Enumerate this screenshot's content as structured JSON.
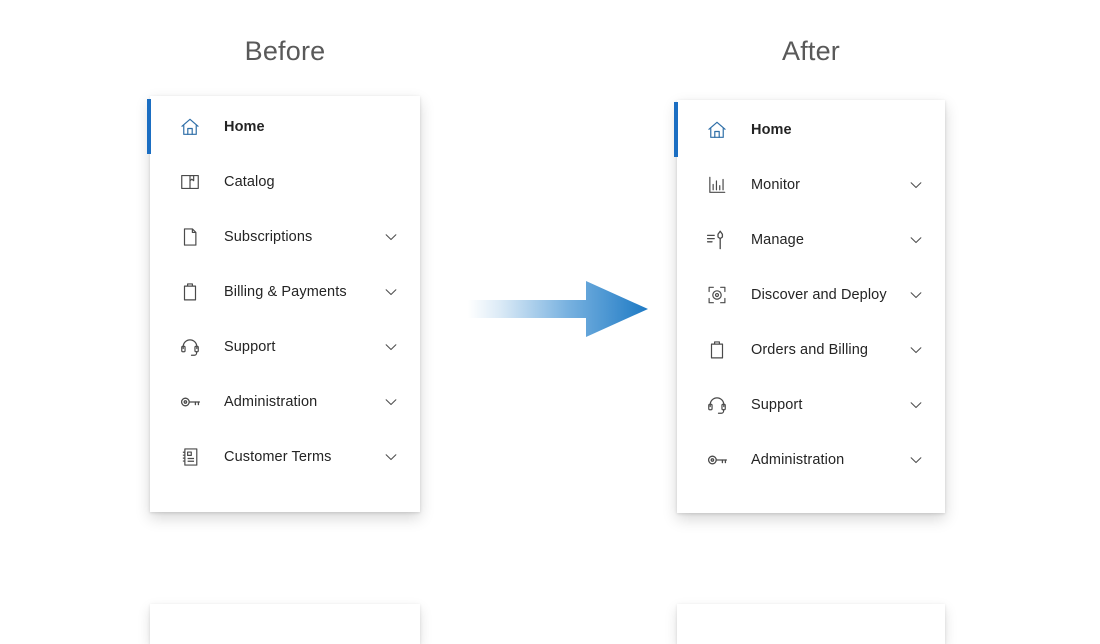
{
  "headings": {
    "before": "Before",
    "after": "After"
  },
  "colors": {
    "accent_blue": "#1b6ec2",
    "arrow_blue": "#1e7ac4",
    "heading_gray": "#595959",
    "label_dark": "#242424",
    "icon_gray": "#4a4a4a",
    "panel_white": "#ffffff",
    "page_background": "#ffffff"
  },
  "arrow": {
    "name": "transition-arrow",
    "direction": "right",
    "gradient_from": "#ffffff",
    "gradient_to": "#1e7ac4"
  },
  "before_panel": {
    "name": "before-navigation-panel",
    "items": [
      {
        "label": "Home",
        "icon": "home-icon",
        "active": true,
        "expandable": false
      },
      {
        "label": "Catalog",
        "icon": "book-icon",
        "active": false,
        "expandable": false
      },
      {
        "label": "Subscriptions",
        "icon": "page-icon",
        "active": false,
        "expandable": true
      },
      {
        "label": "Billing & Payments",
        "icon": "clipboard-icon",
        "active": false,
        "expandable": true
      },
      {
        "label": "Support",
        "icon": "headset-icon",
        "active": false,
        "expandable": true
      },
      {
        "label": "Administration",
        "icon": "key-icon",
        "active": false,
        "expandable": true
      },
      {
        "label": "Customer Terms",
        "icon": "contact-book-icon",
        "active": false,
        "expandable": true
      }
    ]
  },
  "after_panel": {
    "name": "after-navigation-panel",
    "items": [
      {
        "label": "Home",
        "icon": "home-icon",
        "active": true,
        "expandable": false
      },
      {
        "label": "Monitor",
        "icon": "bar-chart-icon",
        "active": false,
        "expandable": true
      },
      {
        "label": "Manage",
        "icon": "wrench-icon",
        "active": false,
        "expandable": true
      },
      {
        "label": "Discover and Deploy",
        "icon": "scan-target-icon",
        "active": false,
        "expandable": true
      },
      {
        "label": "Orders and Billing",
        "icon": "clipboard-icon",
        "active": false,
        "expandable": true
      },
      {
        "label": "Support",
        "icon": "headset-icon",
        "active": false,
        "expandable": true
      },
      {
        "label": "Administration",
        "icon": "key-icon",
        "active": false,
        "expandable": true
      }
    ]
  }
}
